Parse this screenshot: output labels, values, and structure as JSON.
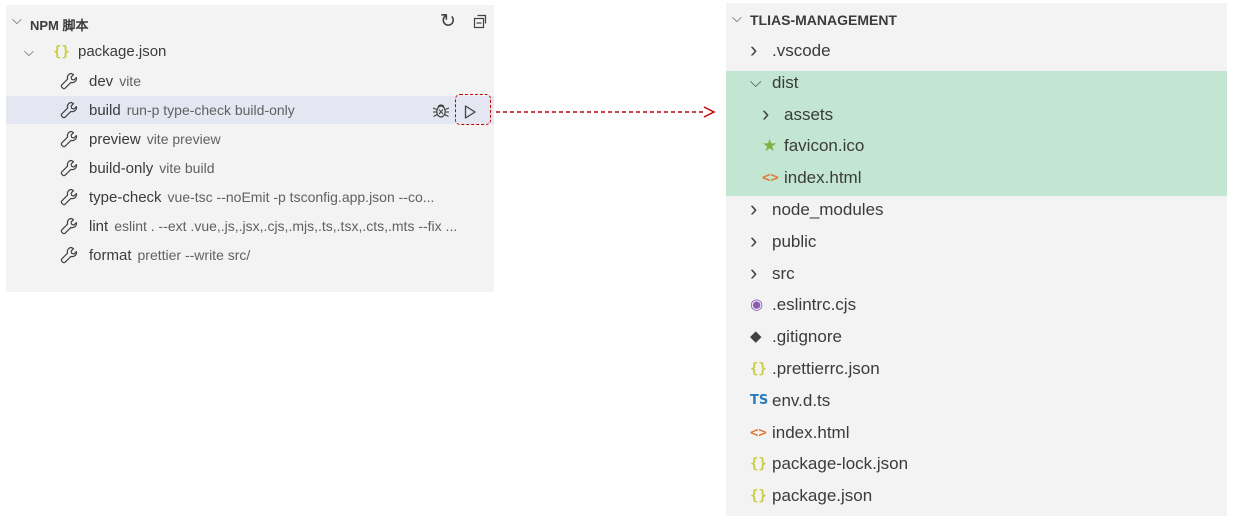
{
  "npm": {
    "header": {
      "chevron": "chevron-down-icon",
      "title": "NPM 脚本",
      "actions": [
        "refresh-icon",
        "collapse-all-icon"
      ]
    },
    "package": {
      "icon": "json-icon",
      "icon_glyph": "{}",
      "label": "package.json"
    },
    "scripts": [
      {
        "name": "dev",
        "cmd": "vite"
      },
      {
        "name": "build",
        "cmd": "run-p type-check build-only",
        "selected": true
      },
      {
        "name": "preview",
        "cmd": "vite preview"
      },
      {
        "name": "build-only",
        "cmd": "vite build"
      },
      {
        "name": "type-check",
        "cmd": "vue-tsc --noEmit -p tsconfig.app.json --co..."
      },
      {
        "name": "lint",
        "cmd": "eslint . --ext .vue,.js,.jsx,.cjs,.mjs,.ts,.tsx,.cts,.mts --fix ..."
      },
      {
        "name": "format",
        "cmd": "prettier --write src/"
      }
    ],
    "row_actions": [
      "debug-icon",
      "run-icon"
    ]
  },
  "colors": {
    "highlight_border": "#c00000",
    "dist_highlight": "#c2e6d2",
    "panel_bg": "#f3f3f3",
    "selected_row": "#e4e6f1",
    "json_icon": "#cbcb41",
    "html_icon": "#e37933",
    "ts_icon": "#2b7bbd",
    "eslint_icon": "#8c5bb5",
    "favicon_icon": "#7cb342"
  },
  "explorer": {
    "title": "TLIAS-MANAGEMENT",
    "items": [
      {
        "label": ".vscode",
        "icon": "chevron-right-icon",
        "glyph": "›",
        "depth": 1,
        "type": "folder"
      },
      {
        "label": "dist",
        "icon": "chevron-down-icon",
        "glyph": "⌄",
        "depth": 1,
        "type": "folder",
        "highlighted": true
      },
      {
        "label": "assets",
        "icon": "chevron-right-icon",
        "glyph": "›",
        "depth": 2,
        "type": "folder",
        "highlighted": true
      },
      {
        "label": "favicon.ico",
        "icon": "star-icon",
        "glyph": "★",
        "depth": 2,
        "type": "file",
        "highlighted": true
      },
      {
        "label": "index.html",
        "icon": "html-icon",
        "glyph": "<>",
        "depth": 2,
        "type": "file",
        "highlighted": true
      },
      {
        "label": "node_modules",
        "icon": "chevron-right-icon",
        "glyph": "›",
        "depth": 1,
        "type": "folder"
      },
      {
        "label": "public",
        "icon": "chevron-right-icon",
        "glyph": "›",
        "depth": 1,
        "type": "folder"
      },
      {
        "label": "src",
        "icon": "chevron-right-icon",
        "glyph": "›",
        "depth": 1,
        "type": "folder"
      },
      {
        "label": ".eslintrc.cjs",
        "icon": "eslint-icon",
        "glyph": "◉",
        "depth": 1,
        "type": "file"
      },
      {
        "label": ".gitignore",
        "icon": "git-icon",
        "glyph": "◆",
        "depth": 1,
        "type": "file"
      },
      {
        "label": ".prettierrc.json",
        "icon": "json-icon",
        "glyph": "{}",
        "depth": 1,
        "type": "file"
      },
      {
        "label": "env.d.ts",
        "icon": "typescript-icon",
        "glyph": "TS",
        "depth": 1,
        "type": "file"
      },
      {
        "label": "index.html",
        "icon": "html-icon",
        "glyph": "<>",
        "depth": 1,
        "type": "file"
      },
      {
        "label": "package-lock.json",
        "icon": "json-icon",
        "glyph": "{}",
        "depth": 1,
        "type": "file"
      },
      {
        "label": "package.json",
        "icon": "json-icon",
        "glyph": "{}",
        "depth": 1,
        "type": "file"
      }
    ]
  }
}
